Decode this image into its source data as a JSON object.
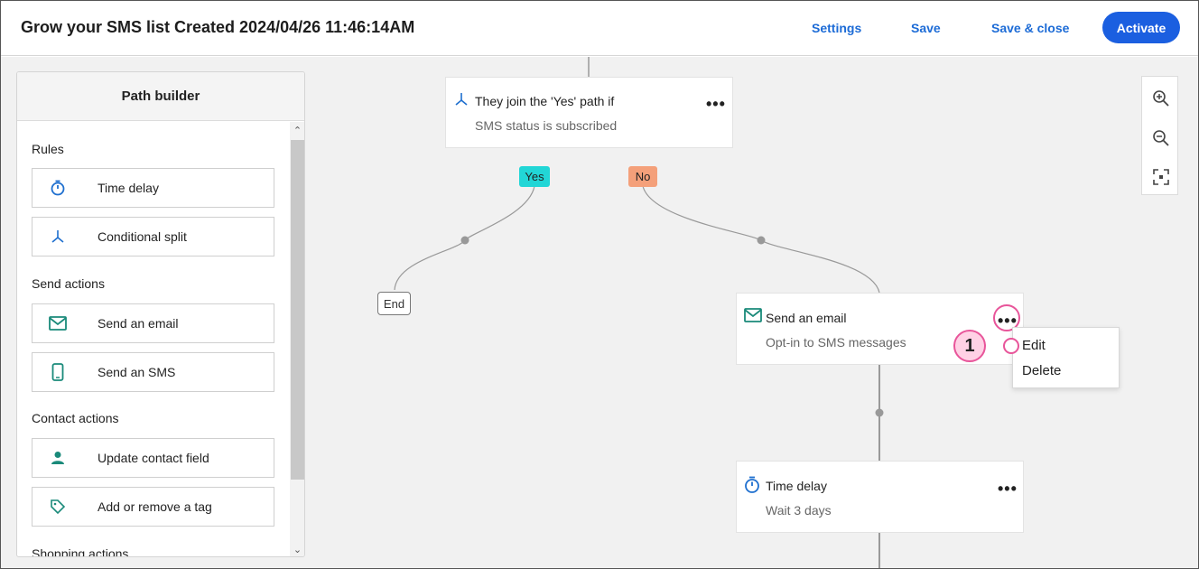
{
  "header": {
    "title": "Grow your SMS list Created 2024/04/26 11:46:14AM",
    "settings": "Settings",
    "save": "Save",
    "save_close": "Save & close",
    "activate": "Activate"
  },
  "panel": {
    "title": "Path builder",
    "sections": {
      "rules": "Rules",
      "send_actions": "Send actions",
      "contact_actions": "Contact actions",
      "shopping_actions": "Shopping actions"
    },
    "items": {
      "time_delay": "Time delay",
      "conditional_split": "Conditional split",
      "send_email": "Send an email",
      "send_sms": "Send an SMS",
      "update_contact": "Update contact field",
      "add_remove_tag": "Add or remove a tag"
    }
  },
  "flow": {
    "split_card": {
      "title": "They join the 'Yes' path if",
      "subtitle": "SMS status is subscribed"
    },
    "yes_label": "Yes",
    "no_label": "No",
    "end_label": "End",
    "email_card": {
      "title": "Send an email",
      "subtitle": "Opt-in to SMS messages"
    },
    "delay_card": {
      "title": "Time delay",
      "subtitle": "Wait 3 days"
    },
    "more_glyph": "•••"
  },
  "context_menu": {
    "edit": "Edit",
    "delete": "Delete"
  },
  "callout": {
    "number": "1"
  },
  "colors": {
    "accent": "#1b5fe0",
    "link": "#1c6bd6",
    "yes_tag": "#22d6d6",
    "no_tag": "#f4a07a",
    "highlight": "#e8559a",
    "icon_teal": "#1a8a7a",
    "icon_blue": "#1e6fcf"
  }
}
